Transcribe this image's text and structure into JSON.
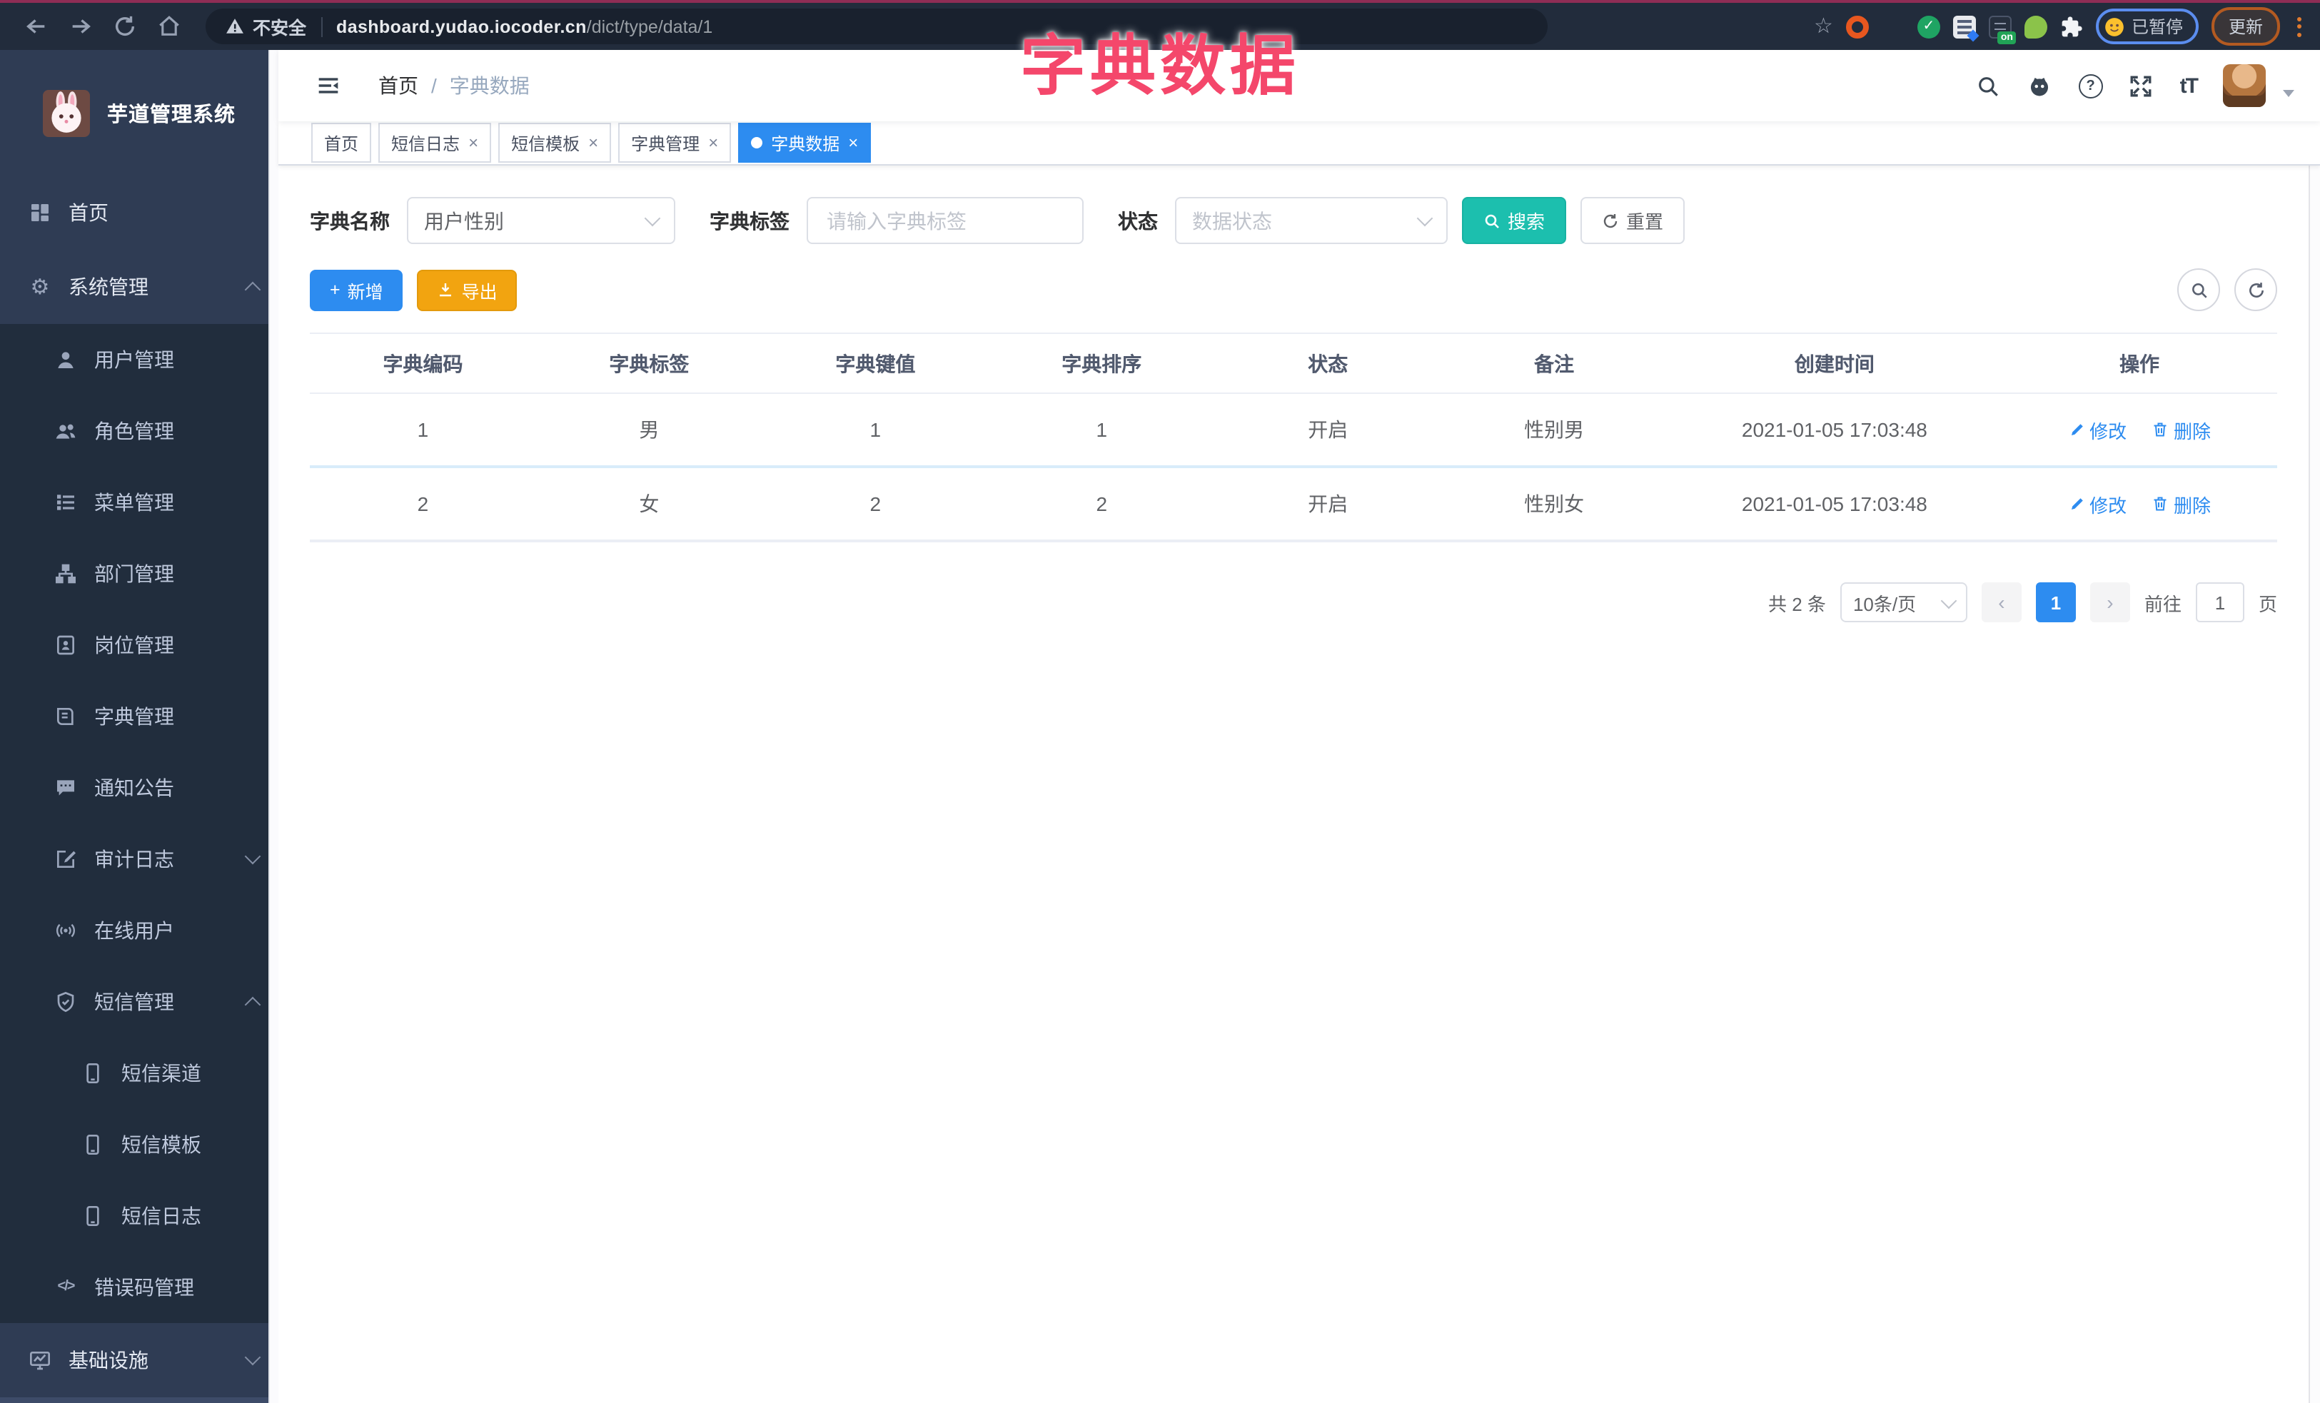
{
  "browser": {
    "security_label": "不安全",
    "url_domain": "dashboard.yudao.iocoder.cn",
    "url_path": "/dict/type/data/1",
    "paused_badge": "已暂停",
    "update_button": "更新",
    "extension_on_badge": "on"
  },
  "overlay_title": "字典数据",
  "sidebar": {
    "app_title": "芋道管理系统",
    "items": [
      {
        "label": "首页"
      },
      {
        "label": "系统管理"
      },
      {
        "label": "用户管理"
      },
      {
        "label": "角色管理"
      },
      {
        "label": "菜单管理"
      },
      {
        "label": "部门管理"
      },
      {
        "label": "岗位管理"
      },
      {
        "label": "字典管理"
      },
      {
        "label": "通知公告"
      },
      {
        "label": "审计日志"
      },
      {
        "label": "在线用户"
      },
      {
        "label": "短信管理"
      },
      {
        "label": "短信渠道"
      },
      {
        "label": "短信模板"
      },
      {
        "label": "短信日志"
      },
      {
        "label": "错误码管理"
      },
      {
        "label": "基础设施"
      }
    ]
  },
  "header": {
    "breadcrumb_home": "首页",
    "breadcrumb_sep": "/",
    "breadcrumb_current": "字典数据"
  },
  "tabs": [
    {
      "label": "首页"
    },
    {
      "label": "短信日志"
    },
    {
      "label": "短信模板"
    },
    {
      "label": "字典管理"
    },
    {
      "label": "字典数据"
    }
  ],
  "filters": {
    "dict_type_label": "字典名称",
    "dict_type_value": "用户性别",
    "dict_label_label": "字典标签",
    "dict_label_placeholder": "请输入字典标签",
    "status_label": "状态",
    "status_placeholder": "数据状态",
    "search_button": "搜索",
    "reset_button": "重置"
  },
  "toolbar": {
    "add_button": "新增",
    "export_button": "导出"
  },
  "table": {
    "headers": [
      "字典编码",
      "字典标签",
      "字典键值",
      "字典排序",
      "状态",
      "备注",
      "创建时间",
      "操作"
    ],
    "rows": [
      {
        "cells": [
          "1",
          "男",
          "1",
          "1",
          "开启",
          "性别男",
          "2021-01-05 17:03:48"
        ]
      },
      {
        "cells": [
          "2",
          "女",
          "2",
          "2",
          "开启",
          "性别女",
          "2021-01-05 17:03:48"
        ]
      }
    ],
    "edit_label": "修改",
    "delete_label": "删除"
  },
  "pagination": {
    "total_text": "共 2 条",
    "page_size": "10条/页",
    "current_page": "1",
    "goto_label": "前往",
    "goto_value": "1",
    "page_unit": "页"
  },
  "icons": {
    "close": "×",
    "star": "☆",
    "gear": "⚙",
    "question": "?",
    "font_size": "tT",
    "plus": "+",
    "code": "</>",
    "check": "✓",
    "prev": "‹",
    "next": "›"
  },
  "colors": {
    "accent_blue": "#2d8cf0",
    "search_teal": "#1cbfae",
    "export_orange": "#f2a410",
    "title_pink": "#f4476b",
    "sidebar_bg": "#2f3c54",
    "submenu_bg": "#212d3d"
  }
}
